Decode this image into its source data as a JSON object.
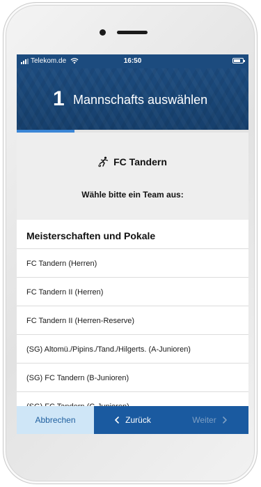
{
  "status_bar": {
    "carrier": "Telekom.de",
    "time": "16:50"
  },
  "header": {
    "step_number": "1",
    "step_title": "Mannschafts auswählen",
    "progress": 0.25,
    "progress_color": "#3b86d6"
  },
  "club": {
    "name": "FC Tandern",
    "icon": "soccer-player-icon",
    "prompt": "Wähle bitte ein Team aus:"
  },
  "list": {
    "heading": "Meisterschaften und Pokale",
    "items": [
      "FC Tandern (Herren)",
      "FC Tandern II (Herren)",
      "FC Tandern II (Herren-Reserve)",
      "(SG) Altomü./Pipins./Tand./Hilgerts. (A-Junioren)",
      "(SG) FC Tandern (B-Junioren)",
      "(SG) FC Tandern (C-Junioren)"
    ]
  },
  "buttons": {
    "cancel": "Abbrechen",
    "back": "Zurück",
    "next": "Weiter"
  },
  "colors": {
    "header_bg": "#1c4b7e",
    "button_bar": "#1a5aa0",
    "cancel_bg": "#cfe6f7"
  }
}
